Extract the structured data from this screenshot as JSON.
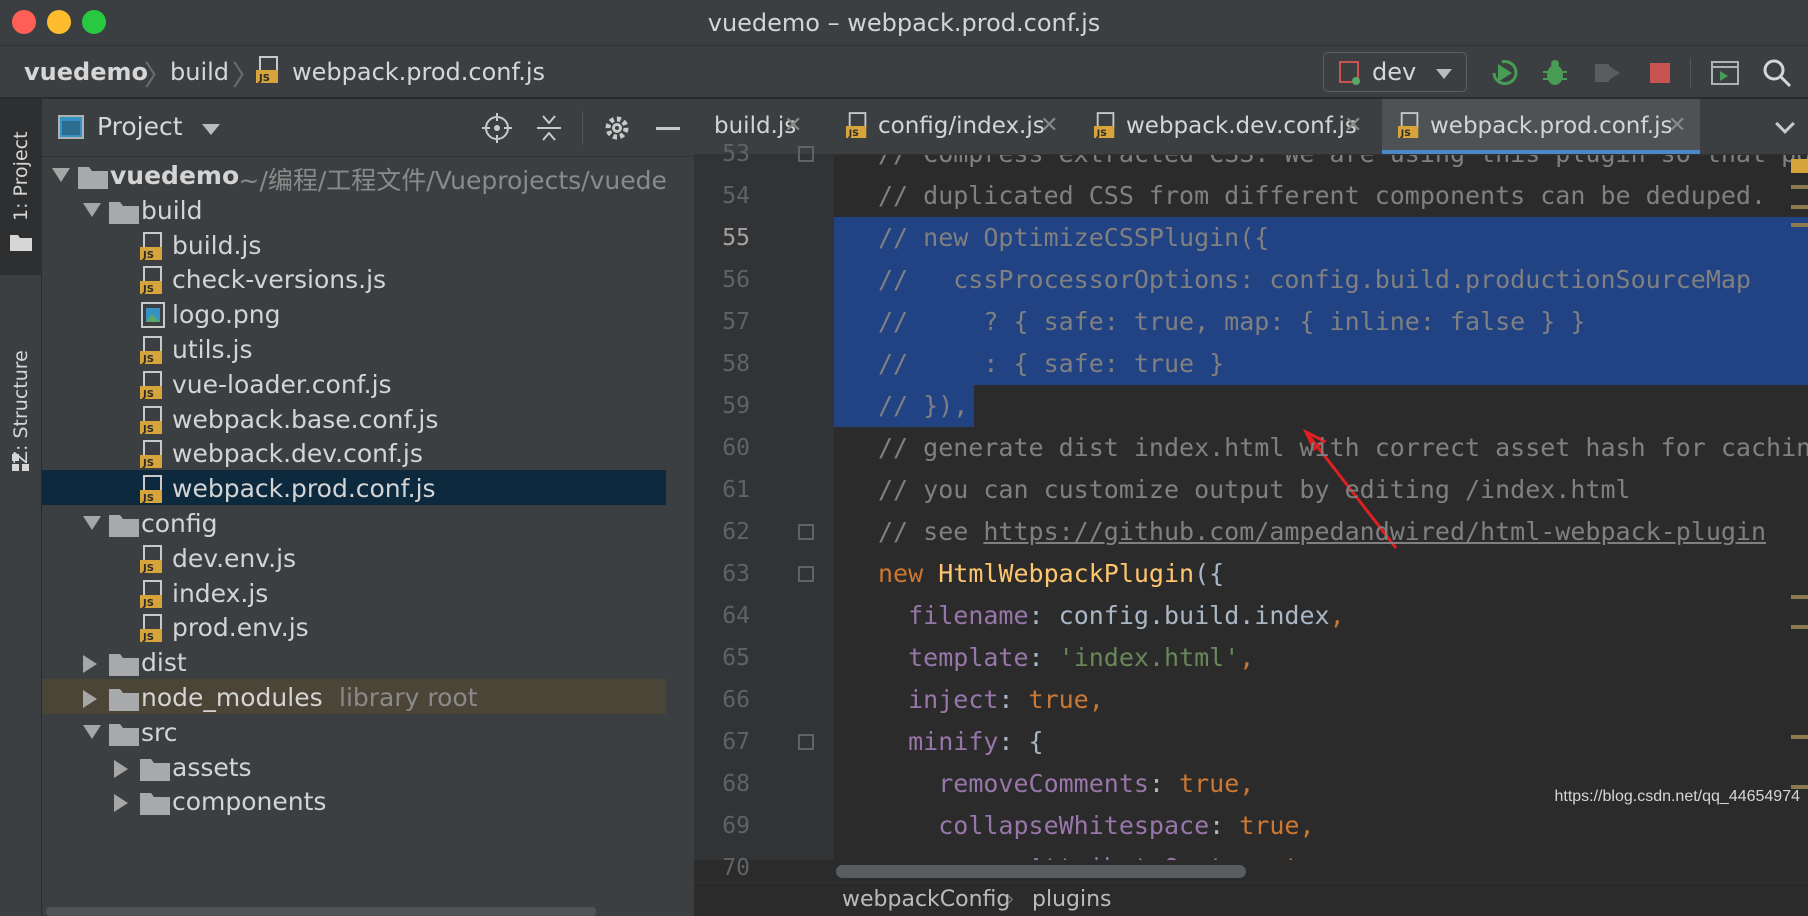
{
  "window": {
    "title": "vuedemo – webpack.prod.conf.js",
    "traffic_colors": [
      "#ff5f57",
      "#febc2e",
      "#28c840"
    ]
  },
  "navbar": {
    "crumbs": [
      "vuedemo",
      "build",
      "webpack.prod.conf.js"
    ],
    "run_config": "dev",
    "icons": [
      "rerun-icon",
      "debug-icon",
      "profile-icon",
      "stop-icon",
      "layout-icon",
      "search-icon"
    ]
  },
  "stripe": {
    "project_label": "1: Project",
    "structure_label": "Z: Structure"
  },
  "project_panel": {
    "title": "Project",
    "tree": [
      {
        "label": "vuedemo",
        "hint": "~/编程/工程文件/Vueprojects/vuedemo",
        "kind": "folder",
        "depth": 0,
        "expanded": true
      },
      {
        "label": "build",
        "kind": "folder",
        "depth": 1,
        "expanded": true
      },
      {
        "label": "build.js",
        "kind": "js",
        "depth": 2
      },
      {
        "label": "check-versions.js",
        "kind": "js",
        "depth": 2
      },
      {
        "label": "logo.png",
        "kind": "png",
        "depth": 2
      },
      {
        "label": "utils.js",
        "kind": "js",
        "depth": 2
      },
      {
        "label": "vue-loader.conf.js",
        "kind": "js",
        "depth": 2
      },
      {
        "label": "webpack.base.conf.js",
        "kind": "js",
        "depth": 2
      },
      {
        "label": "webpack.dev.conf.js",
        "kind": "js",
        "depth": 2
      },
      {
        "label": "webpack.prod.conf.js",
        "kind": "js",
        "depth": 2,
        "selected": true
      },
      {
        "label": "config",
        "kind": "folder",
        "depth": 1,
        "expanded": true
      },
      {
        "label": "dev.env.js",
        "kind": "js",
        "depth": 2
      },
      {
        "label": "index.js",
        "kind": "js",
        "depth": 2
      },
      {
        "label": "prod.env.js",
        "kind": "js",
        "depth": 2
      },
      {
        "label": "dist",
        "kind": "folder",
        "depth": 1,
        "expanded": false
      },
      {
        "label": "node_modules",
        "hint": "library root",
        "kind": "folder",
        "depth": 1,
        "expanded": false,
        "lib": true
      },
      {
        "label": "src",
        "kind": "folder",
        "depth": 1,
        "expanded": true
      },
      {
        "label": "assets",
        "kind": "folder",
        "depth": 2,
        "expanded": false
      },
      {
        "label": "components",
        "kind": "folder",
        "depth": 2,
        "expanded": false
      }
    ]
  },
  "editor": {
    "tabs": [
      {
        "label": "build.js",
        "active": false
      },
      {
        "label": "config/index.js",
        "active": false
      },
      {
        "label": "webpack.dev.conf.js",
        "active": false
      },
      {
        "label": "webpack.prod.conf.js",
        "active": true
      }
    ],
    "current_line": 55,
    "lines": [
      {
        "n": 53,
        "segs": [
          [
            "c-com",
            "// Compress extracted CSS. We are using this plugin so that possible"
          ]
        ]
      },
      {
        "n": 54,
        "segs": [
          [
            "c-com",
            "// duplicated CSS from different components can be deduped."
          ]
        ]
      },
      {
        "n": 55,
        "segs": [
          [
            "c-com",
            "// new OptimizeCSSPlugin({"
          ]
        ],
        "selected": true
      },
      {
        "n": 56,
        "segs": [
          [
            "c-com",
            "//   cssProcessorOptions: config.build.productionSourceMap"
          ]
        ],
        "selected": true
      },
      {
        "n": 57,
        "segs": [
          [
            "c-com",
            "//     ? { safe: true, map: { inline: false } }"
          ]
        ],
        "selected": true
      },
      {
        "n": 58,
        "segs": [
          [
            "c-com",
            "//     : { safe: true }"
          ]
        ],
        "selected": true
      },
      {
        "n": 59,
        "segs": [
          [
            "c-com",
            "// }),"
          ]
        ],
        "selected": true
      },
      {
        "n": 60,
        "segs": [
          [
            "c-com",
            "// generate dist index.html with correct asset hash for caching."
          ]
        ]
      },
      {
        "n": 61,
        "segs": [
          [
            "c-com",
            "// you can customize output by editing /index.html"
          ]
        ]
      },
      {
        "n": 62,
        "segs": [
          [
            "c-com",
            "// see "
          ],
          [
            "c-link",
            "https://github.com/ampedandwired/html-webpack-plugin"
          ]
        ]
      },
      {
        "n": 63,
        "segs": [
          [
            "c-key",
            "new "
          ],
          [
            "c-fn",
            "HtmlWebpackPlugin"
          ],
          [
            "c-plain",
            "({"
          ]
        ]
      },
      {
        "n": 64,
        "segs": [
          [
            "c-plain",
            "  "
          ],
          [
            "c-prop",
            "filename"
          ],
          [
            "c-plain",
            ": "
          ],
          [
            "c-plain",
            "config.build.index"
          ],
          [
            "c-key",
            ","
          ]
        ]
      },
      {
        "n": 65,
        "segs": [
          [
            "c-plain",
            "  "
          ],
          [
            "c-prop",
            "template"
          ],
          [
            "c-plain",
            ": "
          ],
          [
            "c-str",
            "'index.html'"
          ],
          [
            "c-key",
            ","
          ]
        ]
      },
      {
        "n": 66,
        "segs": [
          [
            "c-plain",
            "  "
          ],
          [
            "c-prop",
            "inject"
          ],
          [
            "c-plain",
            ": "
          ],
          [
            "c-key",
            "true,"
          ]
        ]
      },
      {
        "n": 67,
        "segs": [
          [
            "c-plain",
            "  "
          ],
          [
            "c-prop",
            "minify"
          ],
          [
            "c-plain",
            ": {"
          ]
        ]
      },
      {
        "n": 68,
        "segs": [
          [
            "c-plain",
            "    "
          ],
          [
            "c-prop",
            "removeComments"
          ],
          [
            "c-plain",
            ": "
          ],
          [
            "c-key",
            "true,"
          ]
        ]
      },
      {
        "n": 69,
        "segs": [
          [
            "c-plain",
            "    "
          ],
          [
            "c-prop",
            "collapseWhitespace"
          ],
          [
            "c-plain",
            ": "
          ],
          [
            "c-key",
            "true,"
          ]
        ]
      },
      {
        "n": 70,
        "segs": [
          [
            "c-plain",
            "    "
          ],
          [
            "c-prop",
            "removeAttributeQuotes"
          ],
          [
            "c-plain",
            ": "
          ],
          [
            "c-key",
            "true"
          ]
        ]
      }
    ],
    "breadcrumbs": [
      "webpackConfig",
      "plugins"
    ]
  },
  "watermark": "https://blog.csdn.net/qq_44654974"
}
